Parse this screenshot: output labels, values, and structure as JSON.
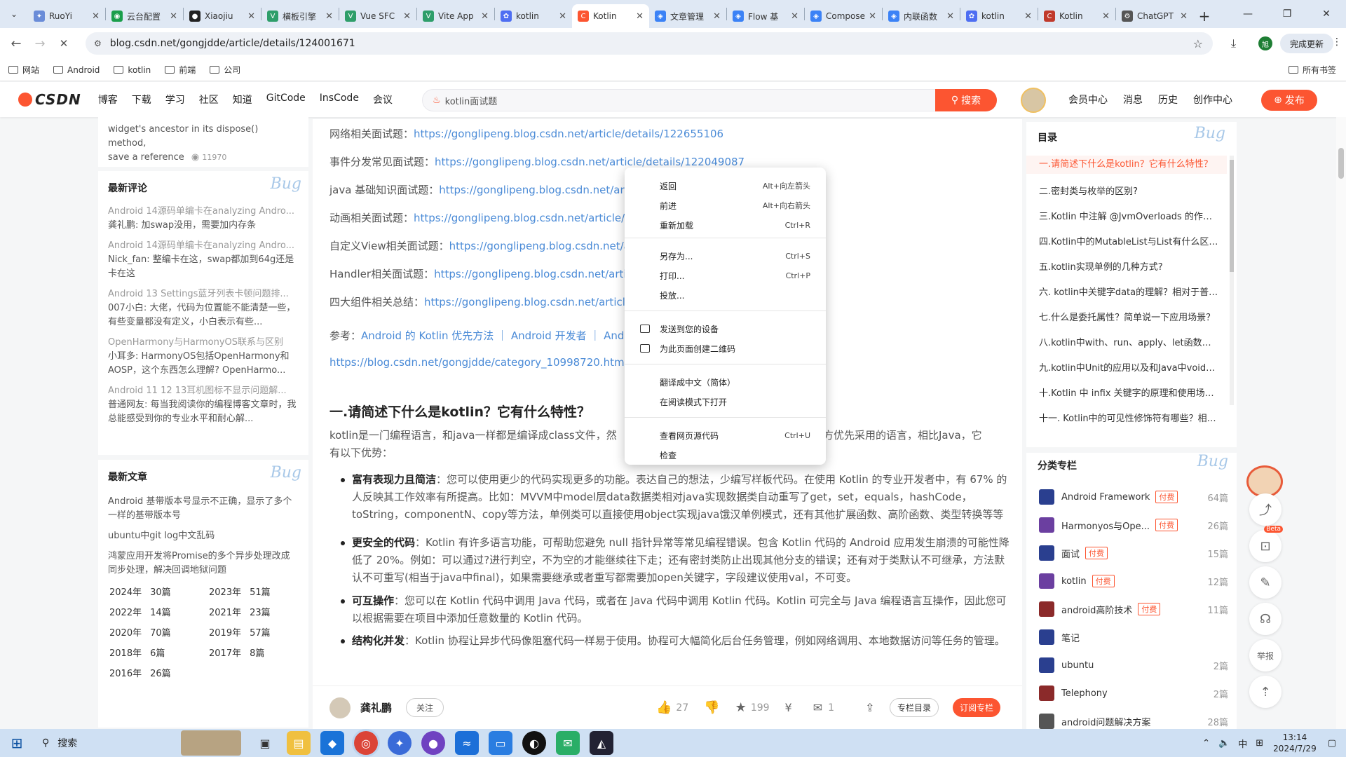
{
  "browser": {
    "tabs": [
      {
        "title": "RuoYi",
        "color": "#6a8cd8",
        "glyph": "✦"
      },
      {
        "title": "云台配置",
        "color": "#1a9e4b",
        "glyph": "◉"
      },
      {
        "title": "Xiaojiu",
        "color": "#222222",
        "glyph": "●"
      },
      {
        "title": "横板引擎",
        "color": "#2e9e6a",
        "glyph": "V"
      },
      {
        "title": "Vue SFC",
        "color": "#2e9e6a",
        "glyph": "V"
      },
      {
        "title": "Vite App",
        "color": "#2e9e6a",
        "glyph": "V"
      },
      {
        "title": "kotlin",
        "color": "#4e6ef2",
        "glyph": "✿"
      },
      {
        "title": "Kotlin",
        "color": "#fc5531",
        "glyph": "C",
        "active": true
      },
      {
        "title": "文章管理",
        "color": "#3b82f6",
        "glyph": "◈"
      },
      {
        "title": "Flow 基",
        "color": "#3b82f6",
        "glyph": "◈"
      },
      {
        "title": "Compose",
        "color": "#3b82f6",
        "glyph": "◈"
      },
      {
        "title": "内联函数",
        "color": "#3b82f6",
        "glyph": "◈"
      },
      {
        "title": "kotlin",
        "color": "#4e6ef2",
        "glyph": "✿"
      },
      {
        "title": "Kotlin",
        "color": "#c0392b",
        "glyph": "C"
      },
      {
        "title": "ChatGPT",
        "color": "#555555",
        "glyph": "⚙"
      }
    ],
    "new_tab": "+",
    "url": "blog.csdn.net/gongjdde/article/details/124001671",
    "update_btn": "完成更新",
    "bookmarks": [
      "网站",
      "Android",
      "kotlin",
      "前端",
      "公司"
    ],
    "all_bookmarks": "所有书签"
  },
  "csdn": {
    "logo": "CSDN",
    "nav": [
      "博客",
      "下载",
      "学习",
      "社区",
      "知道",
      "GitCode",
      "InsCode",
      "会议"
    ],
    "search_placeholder": "kotlin面试题",
    "search_btn": "搜索",
    "right_nav": [
      "会员中心",
      "消息",
      "历史",
      "创作中心"
    ],
    "publish_btn": "发布"
  },
  "left": {
    "top_snip_1": "widget's ancestor in its dispose() method,",
    "top_snip_2": "save a reference",
    "top_snip_views": "11970",
    "comments_title": "最新评论",
    "comments": [
      {
        "title": "Android 14源码单编卡在analyzing Andro...",
        "text": "龚礼鹏: 加swap没用，需要加内存条"
      },
      {
        "title": "Android 14源码单编卡在analyzing Andro...",
        "text": "Nick_fan: 整编卡在这，swap都加到64g还是卡在这"
      },
      {
        "title": "Android 13 Settings蓝牙列表卡顿问题排...",
        "text": "007小白: 大佬，代码为位置能不能清楚一些，有些变量都没有定义，小白表示有些..."
      },
      {
        "title": "OpenHarmony与HarmonyOS联系与区别",
        "text": "小耳多: HarmonyOS包括OpenHarmony和AOSP，这个东西怎么理解? OpenHarmo..."
      },
      {
        "title": "Android 11 12 13耳机图标不显示问题解...",
        "text": "普通网友: 每当我阅读你的编程博客文章时，我总能感受到你的专业水平和耐心解..."
      }
    ],
    "recent_title": "最新文章",
    "recent": [
      "Android 基带版本号显示不正确，显示了多个一样的基带版本号",
      "ubuntu中git log中文乱码",
      "鸿蒙应用开发将Promise的多个异步处理改成同步处理，解决回调地狱问题"
    ],
    "archive": [
      {
        "year": "2024年",
        "count": "30篇"
      },
      {
        "year": "2023年",
        "count": "51篇"
      },
      {
        "year": "2022年",
        "count": "14篇"
      },
      {
        "year": "2021年",
        "count": "23篇"
      },
      {
        "year": "2020年",
        "count": "70篇"
      },
      {
        "year": "2019年",
        "count": "57篇"
      },
      {
        "year": "2018年",
        "count": "6篇"
      },
      {
        "year": "2017年",
        "count": "8篇"
      },
      {
        "year": "2016年",
        "count": "26篇"
      }
    ]
  },
  "article": {
    "links": [
      {
        "label": "网络相关面试题：",
        "url": "https://gonglipeng.blog.csdn.net/article/details/122655106"
      },
      {
        "label": "事件分发常见面试题：",
        "url": "https://gonglipeng.blog.csdn.net/article/details/122049087"
      },
      {
        "label": "java 基础知识面试题：",
        "url": "https://gonglipeng.blog.csdn.net/artic"
      },
      {
        "label": "动画相关面试题：",
        "url": "https://gonglipeng.blog.csdn.net/article/de"
      },
      {
        "label": "自定义View相关面试题：",
        "url": "https://gonglipeng.blog.csdn.net/ar"
      },
      {
        "label": "Handler相关面试题：",
        "url": "https://gonglipeng.blog.csdn.net/article"
      },
      {
        "label": "四大组件相关总结：",
        "url": "https://gonglipeng.blog.csdn.net/article/"
      }
    ],
    "ref_label": "参考：",
    "ref_link": "Android 的 Kotlin 优先方法 ｜ Android 开发者 ｜ Andr",
    "ref_link2": "https://blog.csdn.net/gongjdde/category_10998720.html?sp",
    "heading": "一.请简述下什么是kotlin？它有什么特性？",
    "intro_1": "kotlin是一门编程语言，和java一样都是编译成class文件，然",
    "intro_1b": "方优先采用的语言，相比Java，它",
    "intro_2": "有以下优势：",
    "bullets": [
      {
        "t": "富有表现力且简洁：您可以使用更少的代码实现更多的功能。表达自己的想法，少编写样板代码。在使用 Kotlin 的专业开发者中，有 67% 的人反映其工作效率有所提高。比如：MVVM中model层data数据类相对java实现数据类自动重写了get，set，equals，hashCode，toString，componentN、copy等方法，单例类可以直接使用object实现java饿汉单例模式，还有其他扩展函数、高阶函数、类型转换等等"
      },
      {
        "t": "更安全的代码：Kotlin 有许多语言功能，可帮助您避免 null 指针异常等常见编程错误。包含 Kotlin 代码的 Android 应用发生崩溃的可能性降低了 20%。例如：可以通过?进行判空，不为空的才能继续往下走；还有密封类防止出现其他分支的错误；还有对于类默认不可继承，方法默认不可重写(相当于java中final)，如果需要继承或者重写都需要加open关键字，字段建议使用val，不可变。"
      },
      {
        "t": "可互操作：您可以在 Kotlin 代码中调用 Java 代码，或者在 Java 代码中调用 Kotlin 代码。Kotlin 可完全与 Java 编程语言互操作，因此您可以根据需要在项目中添加任意数量的 Kotlin 代码。"
      },
      {
        "t": "结构化并发：Kotlin 协程让异步代码像阻塞代码一样易于使用。协程可大幅简化后台任务管理，例如网络调用、本地数据访问等任务的管理。"
      }
    ],
    "bold_lead": [
      "富有表现力且简洁",
      "更安全的代码",
      "可互操作",
      "结构化并发"
    ],
    "author": "龚礼鹏",
    "follow": "关注",
    "likes": "27",
    "stars": "199",
    "comments": "1",
    "toc_btn": "专栏目录",
    "sub_btn": "订阅专栏"
  },
  "context_menu": {
    "items": [
      {
        "label": "返回",
        "key": "Alt+向左箭头"
      },
      {
        "label": "前进",
        "key": "Alt+向右箭头"
      },
      {
        "label": "重新加载",
        "key": "Ctrl+R"
      },
      {
        "label": "另存为...",
        "key": "Ctrl+S"
      },
      {
        "label": "打印...",
        "key": "Ctrl+P"
      },
      {
        "label": "投放...",
        "key": ""
      },
      {
        "label": "发送到您的设备",
        "key": ""
      },
      {
        "label": "为此页面创建二维码",
        "key": ""
      },
      {
        "label": "翻译成中文（简体）",
        "key": ""
      },
      {
        "label": "在阅读模式下打开",
        "key": ""
      },
      {
        "label": "查看网页源代码",
        "key": "Ctrl+U"
      },
      {
        "label": "检查",
        "key": ""
      }
    ]
  },
  "right": {
    "toc_title": "目录",
    "toc": [
      "一.请简述下什么是kotlin？它有什么特性？",
      "二.密封类与枚举的区别?",
      "三.Kotlin 中注解 @JvmOverloads 的作用？",
      "四.Kotlin中的MutableList与List有什么区别？",
      "五.kotlin实现单例的几种方式?",
      "六. kotlin中关键字data的理解？相对于普通类？",
      "七.什么是委托属性？简单说一下应用场景？",
      "八.kotlin中with、run、apply、let函数的区别？",
      "九.kotlin中Unit的应用以及和Java中void的区别？",
      "十.Kotlin 中 infix 关键字的原理和使用场景？",
      "十一. Kotlin中的可见性修饰符有哪些？相比java？"
    ],
    "col_title": "分类专栏",
    "columns": [
      {
        "name": "Android Framework",
        "paid": true,
        "count": "64篇",
        "color": "#2a3f8f"
      },
      {
        "name": "Harmonyos与Ope...",
        "paid": true,
        "count": "26篇",
        "color": "#6b3fa0"
      },
      {
        "name": "面试",
        "paid": true,
        "count": "15篇",
        "color": "#2a3f8f"
      },
      {
        "name": "kotlin",
        "paid": true,
        "count": "12篇",
        "color": "#6b3fa0"
      },
      {
        "name": "android高阶技术",
        "paid": true,
        "count": "11篇",
        "color": "#8b2a2a"
      },
      {
        "name": "笔记",
        "paid": false,
        "count": "",
        "color": "#2a3f8f"
      },
      {
        "name": "ubuntu",
        "paid": false,
        "count": "2篇",
        "color": "#2a3f8f"
      },
      {
        "name": "Telephony",
        "paid": false,
        "count": "2篇",
        "color": "#8b2a2a"
      },
      {
        "name": "android问题解决方案",
        "paid": false,
        "count": "28篇",
        "color": "#555555"
      }
    ],
    "paid_label": "付费",
    "beta": "Beta",
    "report": "举报"
  },
  "taskbar": {
    "search": "搜索",
    "time": "13:14",
    "date": "2024/7/29",
    "ime": "中"
  }
}
